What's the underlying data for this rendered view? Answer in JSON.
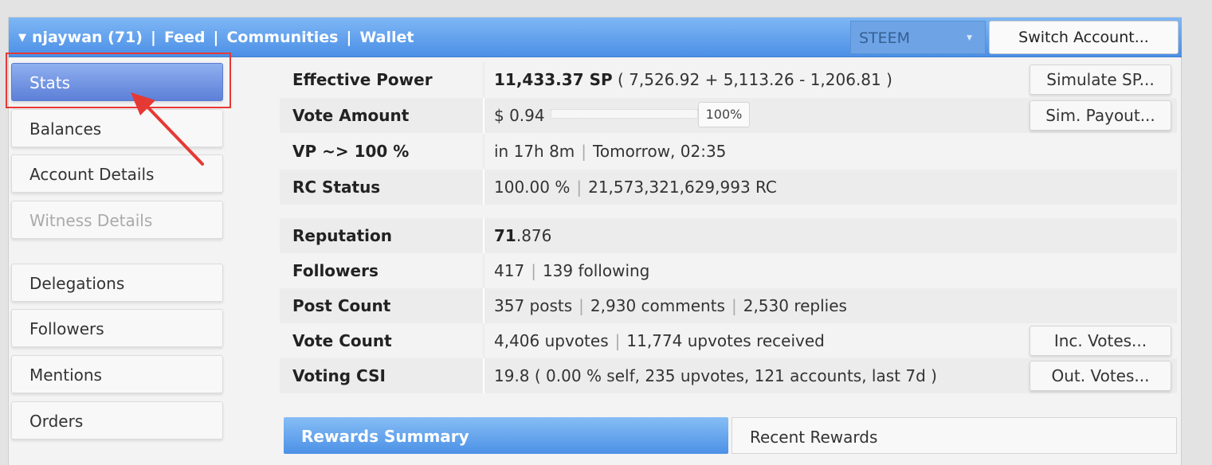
{
  "header": {
    "nav": [
      "njaywan (71)",
      "Feed",
      "Communities",
      "Wallet"
    ],
    "separator": "|",
    "chain_select": "STEEM",
    "switch_account": "Switch Account..."
  },
  "sidebar": {
    "items": [
      {
        "label": "Stats",
        "state": "active"
      },
      {
        "label": "Balances",
        "state": "normal"
      },
      {
        "label": "Account Details",
        "state": "normal"
      },
      {
        "label": "Witness Details",
        "state": "disabled"
      },
      {
        "label": "Delegations",
        "state": "normal"
      },
      {
        "label": "Followers",
        "state": "normal"
      },
      {
        "label": "Mentions",
        "state": "normal"
      },
      {
        "label": "Orders",
        "state": "normal"
      }
    ]
  },
  "stats": {
    "effective_power": {
      "label": "Effective Power",
      "bold_value": "11,433.37 SP",
      "value": "( 7,526.92 + 5,113.26 - 1,206.81 )",
      "button": "Simulate SP..."
    },
    "vote_amount": {
      "label": "Vote Amount",
      "value": "$ 0.94",
      "slider_value": "100%",
      "slider_fraction": 1.0,
      "button": "Sim. Payout..."
    },
    "vp": {
      "label": "VP ~> 100 %",
      "value_a": "in 17h 8m",
      "value_b": "Tomorrow, 02:35"
    },
    "rc": {
      "label": "RC Status",
      "value_a": "100.00 %",
      "value_b": "21,573,321,629,993 RC"
    },
    "reputation": {
      "label": "Reputation",
      "bold_value": "71",
      "value": ".876"
    },
    "followers": {
      "label": "Followers",
      "value_a": "417",
      "value_b": "139 following"
    },
    "post_count": {
      "label": "Post Count",
      "value_a": "357 posts",
      "value_b": "2,930 comments",
      "value_c": "2,530 replies"
    },
    "vote_count": {
      "label": "Vote Count",
      "value_a": "4,406 upvotes",
      "value_b": "11,774 upvotes received",
      "button": "Inc. Votes..."
    },
    "voting_csi": {
      "label": "Voting CSI",
      "value": "19.8 ( 0.00 % self, 235 upvotes, 121 accounts, last 7d )",
      "button": "Out. Votes..."
    }
  },
  "tabs": {
    "rewards_summary": "Rewards Summary",
    "recent_rewards": "Recent Rewards"
  },
  "colors": {
    "accent_blue": "#4b8fe6",
    "annotation_red": "#e53935"
  }
}
